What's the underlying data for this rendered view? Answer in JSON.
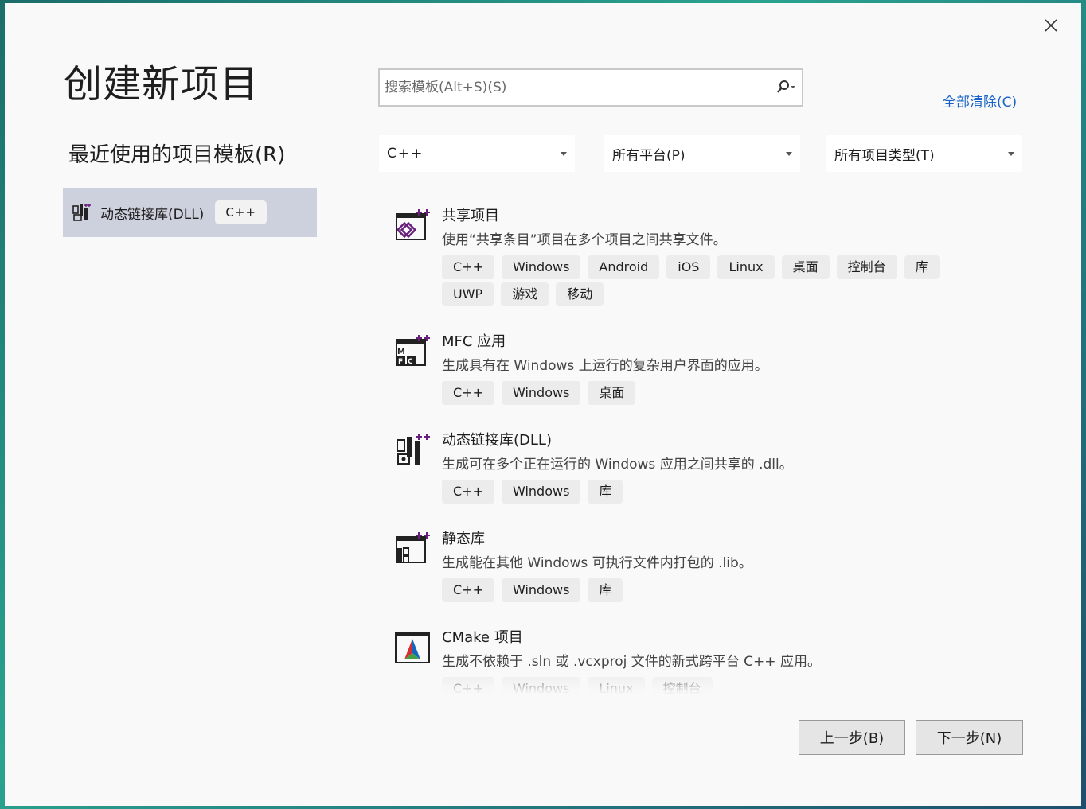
{
  "title": "创建新项目",
  "recent": {
    "heading": "最近使用的项目模板(R)",
    "items": [
      {
        "label": "动态链接库(DLL)",
        "tag": "C++",
        "icon": "dll-project-icon"
      }
    ]
  },
  "search": {
    "placeholder": "搜索模板(Alt+S)(S)",
    "value": ""
  },
  "clear_all": "全部清除(C)",
  "filters": [
    {
      "label": "C++"
    },
    {
      "label": "所有平台(P)"
    },
    {
      "label": "所有项目类型(T)"
    }
  ],
  "templates": [
    {
      "name": "共享项目",
      "description": "使用“共享条目”项目在多个项目之间共享文件。",
      "icon": "shared-project-icon",
      "tags": [
        "C++",
        "Windows",
        "Android",
        "iOS",
        "Linux",
        "桌面",
        "控制台",
        "库",
        "UWP",
        "游戏",
        "移动"
      ]
    },
    {
      "name": "MFC 应用",
      "description": "生成具有在 Windows 上运行的复杂用户界面的应用。",
      "icon": "mfc-app-icon",
      "tags": [
        "C++",
        "Windows",
        "桌面"
      ]
    },
    {
      "name": "动态链接库(DLL)",
      "description": "生成可在多个正在运行的 Windows 应用之间共享的 .dll。",
      "icon": "dll-project-icon",
      "tags": [
        "C++",
        "Windows",
        "库"
      ]
    },
    {
      "name": "静态库",
      "description": "生成能在其他 Windows 可执行文件内打包的 .lib。",
      "icon": "static-library-icon",
      "tags": [
        "C++",
        "Windows",
        "库"
      ]
    },
    {
      "name": "CMake 项目",
      "description": "生成不依赖于 .sln 或 .vcxproj 文件的新式跨平台 C++ 应用。",
      "icon": "cmake-project-icon",
      "tags": [
        "C++",
        "Windows",
        "Linux",
        "控制台"
      ]
    }
  ],
  "buttons": {
    "back": "上一步(B)",
    "next": "下一步(N)"
  },
  "colors": {
    "link": "#1a64c8",
    "selected": "#cdd0dd",
    "accent": "#68217a"
  }
}
